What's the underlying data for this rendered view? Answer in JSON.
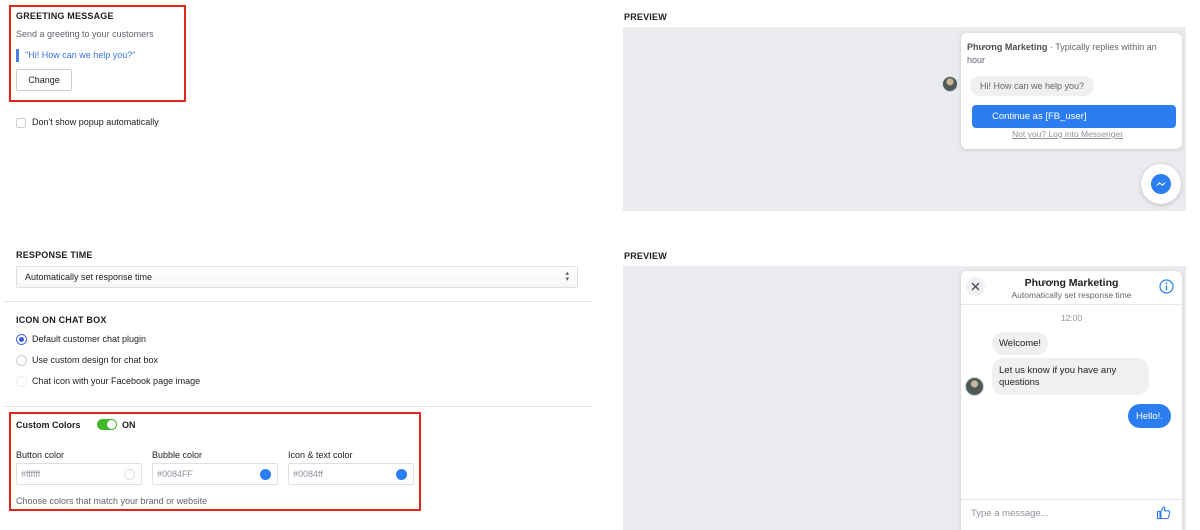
{
  "greeting": {
    "heading": "GREETING MESSAGE",
    "subtitle": "Send a greeting to your customers",
    "message": "\"Hi! How can we help you?\"",
    "change_label": "Change"
  },
  "popup_checkbox": {
    "label": "Don't show popup automatically",
    "checked": false
  },
  "preview1": {
    "heading": "PREVIEW",
    "page_name": "Phương Marketing",
    "reply_info": " · Typically replies within an hour",
    "greeting_bubble": "Hi! How can we help you?",
    "continue_label": "Continue as [FB_user]",
    "not_you_label": "Not you? Log into Messenger",
    "messenger_icon": "messenger-icon"
  },
  "response_time": {
    "heading": "RESPONSE TIME",
    "selected": "Automatically set response time"
  },
  "icon_chat_box": {
    "heading": "ICON ON CHAT BOX",
    "options": [
      {
        "label": "Default customer chat plugin",
        "checked": true
      },
      {
        "label": "Use custom design for chat box",
        "checked": false
      },
      {
        "label": "Chat icon with your Facebook page image",
        "checked": false
      }
    ]
  },
  "custom_colors": {
    "label": "Custom Colors",
    "toggle_state": "ON",
    "fields": [
      {
        "label": "Button color",
        "value": "#ffffff",
        "swatch": "#ffffff"
      },
      {
        "label": "Bubble color",
        "value": "#0084FF",
        "swatch": "#2b7df0"
      },
      {
        "label": "Icon & text color",
        "value": "#0084ff",
        "swatch": "#2b7df0"
      }
    ],
    "hint": "Choose colors that match your brand or website"
  },
  "preview2": {
    "heading": "PREVIEW",
    "page_name": "Phương Marketing",
    "subtitle": "Automatically set response time",
    "time": "12:00",
    "messages_in": [
      "Welcome!",
      "Let us know if you have any questions"
    ],
    "message_out": "Hello!.",
    "input_placeholder": "Type a message...",
    "close_icon": "close-icon",
    "info_icon": "info-icon",
    "like_icon": "thumbs-up-icon"
  },
  "colors": {
    "accent_blue": "#2b7df0",
    "highlight_red": "#e0261b",
    "toggle_green": "#42b72a"
  }
}
